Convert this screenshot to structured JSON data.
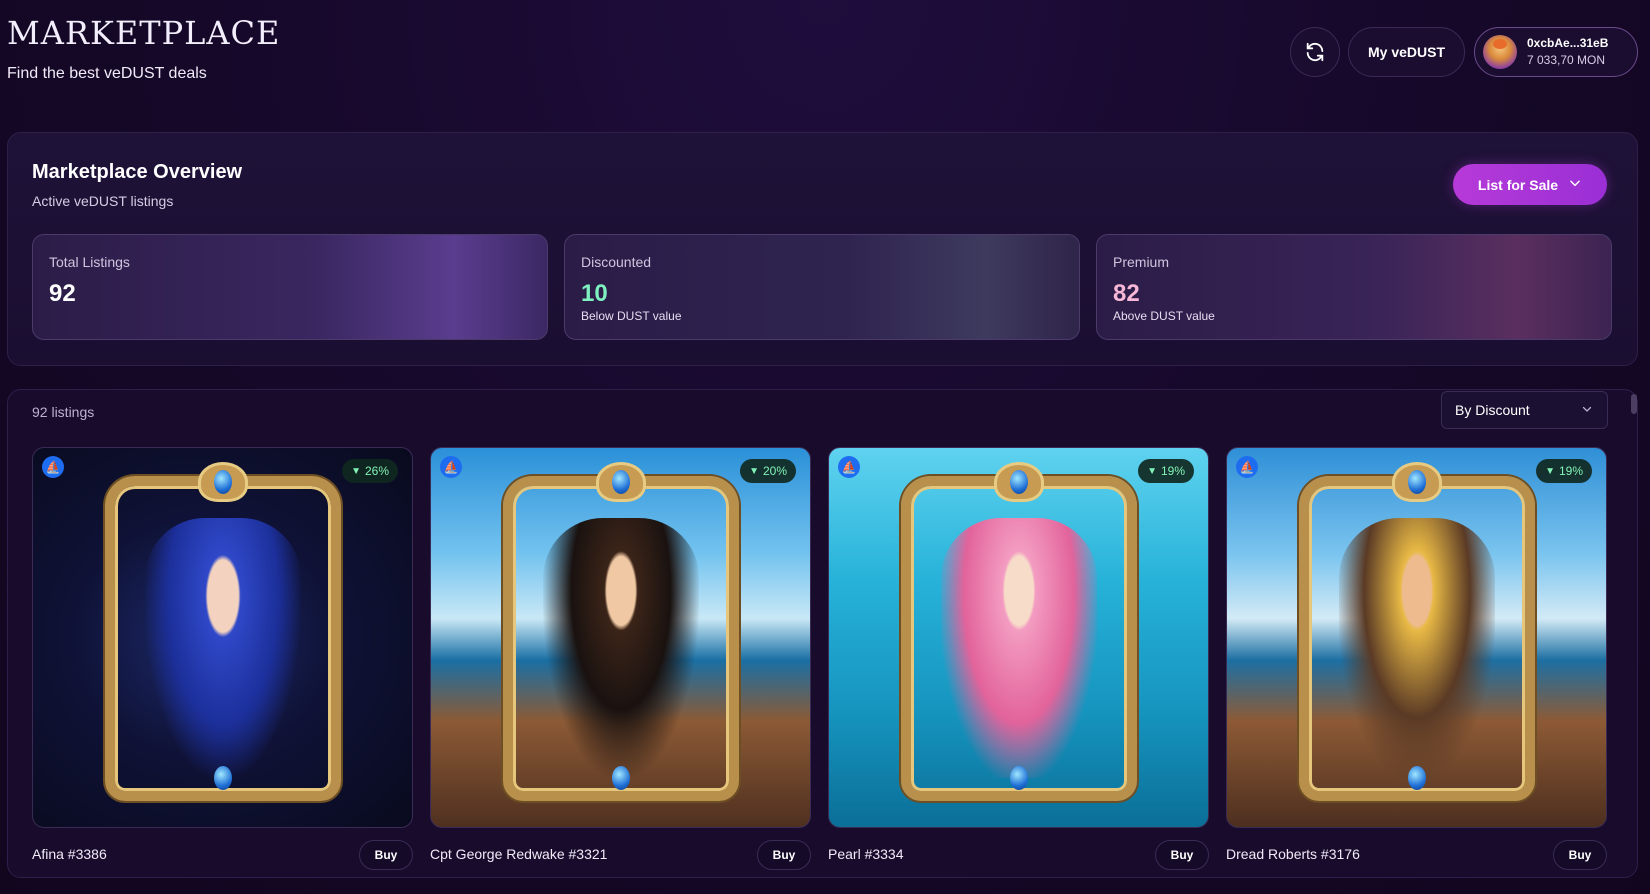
{
  "header": {
    "title": "MARKETPLACE",
    "subtitle": "Find the best veDUST deals",
    "refresh_icon": "refresh-icon",
    "my_vedust_label": "My veDUST",
    "wallet": {
      "address": "0xcbAe...31eB",
      "balance": "7 033,70 MON"
    }
  },
  "overview": {
    "title": "Marketplace Overview",
    "subtitle": "Active veDUST listings",
    "list_for_sale_label": "List for Sale",
    "stats": [
      {
        "label": "Total Listings",
        "value": "92",
        "note": ""
      },
      {
        "label": "Discounted",
        "value": "10",
        "note": "Below DUST value"
      },
      {
        "label": "Premium",
        "value": "82",
        "note": "Above DUST value"
      }
    ]
  },
  "listings": {
    "count_label": "92 listings",
    "sort_selected": "By Discount",
    "items": [
      {
        "name": "Afina #3386",
        "discount": "26%",
        "buy_label": "Buy"
      },
      {
        "name": "Cpt George Redwake #3321",
        "discount": "20%",
        "buy_label": "Buy"
      },
      {
        "name": "Pearl #3334",
        "discount": "19%",
        "buy_label": "Buy"
      },
      {
        "name": "Dread Roberts #3176",
        "discount": "19%",
        "buy_label": "Buy"
      }
    ]
  },
  "colors": {
    "accent": "#b63ad8",
    "discount_green": "#83f2b6",
    "discounted_value": "#7ff0c0",
    "premium_value": "#f7b7d7",
    "chain_blue": "#1e6cf0"
  }
}
